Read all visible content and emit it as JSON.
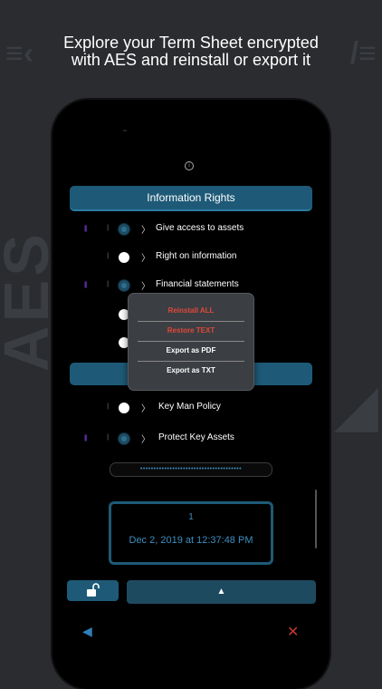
{
  "headline": {
    "line1": "Explore your Term Sheet encrypted",
    "line2": "with AES and reinstall or export it"
  },
  "section_header": "Information Rights",
  "rows": [
    {
      "label": "Give access to assets",
      "state": "off",
      "flag": "|||"
    },
    {
      "label": "Right on information",
      "state": "on",
      "flag": ""
    },
    {
      "label": "Financial statements",
      "state": "off",
      "flag": "|||"
    },
    {
      "label": "",
      "state": "on",
      "flag": ""
    },
    {
      "label": "",
      "state": "on",
      "flag": ""
    },
    {
      "label": "Key Man Policy",
      "state": "on",
      "flag": ""
    },
    {
      "label": "Protect Key Assets",
      "state": "off",
      "flag": "|||"
    }
  ],
  "popup_menu": {
    "items": [
      "Reinstall  ALL",
      "Restore TEXT",
      "Export as PDF",
      "Export as TXT"
    ]
  },
  "password_field": {
    "masked_value": "••••••••••••••••••••••••••••••••••••••"
  },
  "record": {
    "number": "1",
    "date": "Dec 2, 2019 at 12:37:48 PM"
  },
  "toolbar": {
    "up_label": "▲",
    "back_label": "◀",
    "close_label": "✕"
  },
  "glyphs": {
    "chevron": "〉",
    "pause": "||",
    "info": "i"
  },
  "colors": {
    "accent": "#1e5a77",
    "text_blue": "#3e8ec1",
    "danger": "#e0483a",
    "flag": "#7b3fd8"
  }
}
